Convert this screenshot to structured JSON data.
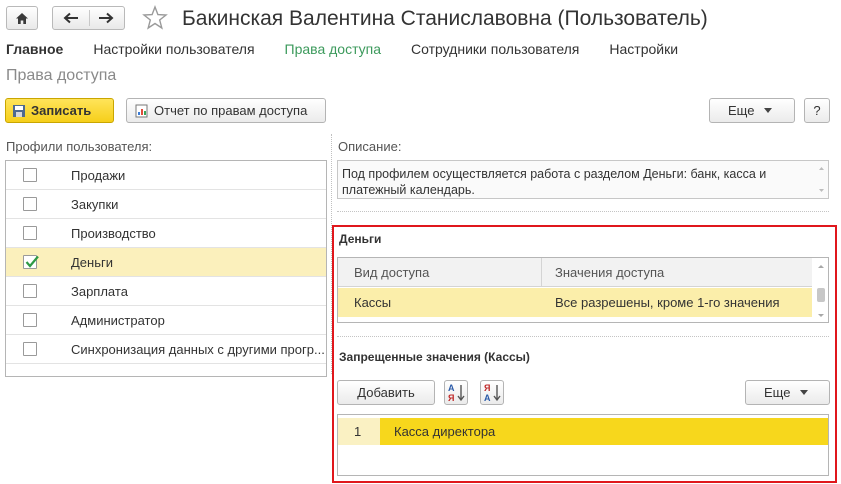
{
  "window": {
    "title": "Бакинская Валентина Станиславовна (Пользователь)"
  },
  "tabs": [
    {
      "label": "Главное"
    },
    {
      "label": "Настройки пользователя"
    },
    {
      "label": "Права доступа"
    },
    {
      "label": "Сотрудники пользователя"
    },
    {
      "label": "Настройки"
    }
  ],
  "section_title": "Права доступа",
  "toolbar": {
    "save_label": "Записать",
    "report_label": "Отчет по правам доступа",
    "more_label": "Еще",
    "help_label": "?"
  },
  "profiles": {
    "label": "Профили пользователя:",
    "items": [
      {
        "label": "Продажи",
        "checked": false
      },
      {
        "label": "Закупки",
        "checked": false
      },
      {
        "label": "Производство",
        "checked": false
      },
      {
        "label": "Деньги",
        "checked": true
      },
      {
        "label": "Зарплата",
        "checked": false
      },
      {
        "label": "Администратор",
        "checked": false
      },
      {
        "label": "Синхронизация данных с другими прогр..."
      }
    ]
  },
  "description": {
    "label": "Описание:",
    "text": "Под профилем осуществляется работа с разделом Деньги: банк, касса и платежный календарь."
  },
  "access": {
    "group_label": "Деньги",
    "columns": [
      "Вид доступа",
      "Значения доступа"
    ],
    "rows": [
      {
        "kind": "Кассы",
        "values": "Все разрешены, кроме 1-го значения"
      }
    ]
  },
  "forbidden": {
    "label": "Запрещенные значения (Кассы)",
    "add_label": "Добавить",
    "more_label": "Еще",
    "rows": [
      {
        "num": "1",
        "value": "Касса директора"
      }
    ]
  },
  "colors": {
    "accent_tab": "#3c9a5c",
    "highlight_box": "#e0171c",
    "primary_button": "#f6cf1a",
    "selected_row": "#f7d71c"
  }
}
